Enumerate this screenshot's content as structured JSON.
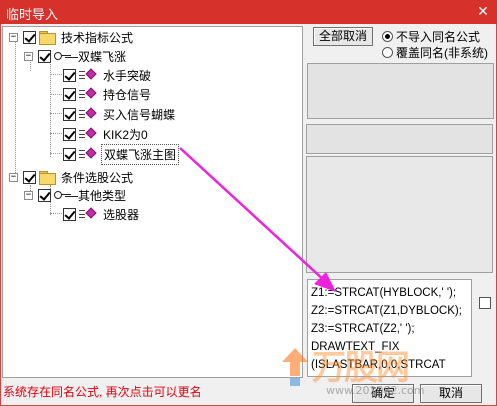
{
  "window": {
    "title": "临时导入",
    "close_glyph": "✕"
  },
  "tree": {
    "nodes": [
      {
        "label": "技术指标公式",
        "icon": "folder-icon",
        "level": 0,
        "checked": true,
        "expander": "−"
      },
      {
        "label": "双蝶飞涨",
        "icon": "key-icon",
        "level": 1,
        "checked": true,
        "expander": "−"
      },
      {
        "label": "水手突破",
        "icon": "formula-icon",
        "level": 2,
        "checked": true
      },
      {
        "label": "持仓信号",
        "icon": "formula-icon",
        "level": 2,
        "checked": true
      },
      {
        "label": "买入信号蝴蝶",
        "icon": "formula-icon",
        "level": 2,
        "checked": true
      },
      {
        "label": "KIK2为0",
        "icon": "formula-icon",
        "level": 2,
        "checked": true
      },
      {
        "label": "双蝶飞涨主图",
        "icon": "formula-icon",
        "level": 2,
        "checked": true,
        "selected": true
      },
      {
        "label": "条件选股公式",
        "icon": "folder-icon",
        "level": 0,
        "checked": true,
        "expander": "−"
      },
      {
        "label": "其他类型",
        "icon": "key-icon",
        "level": 1,
        "checked": true,
        "expander": "−"
      },
      {
        "label": "选股器",
        "icon": "formula-icon",
        "level": 2,
        "checked": true
      }
    ]
  },
  "controls": {
    "cancel_all_label": "全部取消",
    "radio_no_import": "不导入同名公式",
    "radio_overwrite": "覆盖同名(非系统)",
    "selected_radio": "no_import"
  },
  "code_lines": [
    "Z1:=STRCAT(HYBLOCK,' ');",
    "Z2:=STRCAT(Z1,DYBLOCK);",
    "Z3:=STRCAT(Z2,' ');",
    "DRAWTEXT_FIX",
    "(ISLASTBAR,0,0,STRCAT"
  ],
  "status_text": "系统存在同名公式, 再次点击可以更名",
  "buttons": {
    "ok": "确定",
    "cancel": "取消"
  },
  "watermark": {
    "brand": "万股网",
    "url": "www.201082.com"
  },
  "colors": {
    "titlebar": "#d6322b",
    "status": "#e3000f",
    "arrow": "#ee22dd",
    "gem": "#c42ba8"
  }
}
